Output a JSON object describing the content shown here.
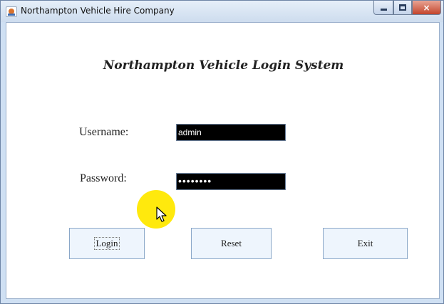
{
  "window": {
    "title": "Northampton Vehicle Hire Company",
    "controls": {
      "minimize": "minimize",
      "maximize": "maximize",
      "close": "×"
    }
  },
  "form": {
    "heading": "Northampton Vehicle Login System",
    "username_label": "Username:",
    "username_value": "admin",
    "password_label": "Password:",
    "password_value": "••••••••"
  },
  "buttons": {
    "login": "Login",
    "reset": "Reset",
    "exit": "Exit"
  },
  "colors": {
    "field_background": "#000000",
    "button_background": "#eef5fd",
    "cursor_highlight": "#ffe800"
  },
  "icons": {
    "app": "java-app-icon",
    "cursor": "mouse-pointer-icon"
  }
}
